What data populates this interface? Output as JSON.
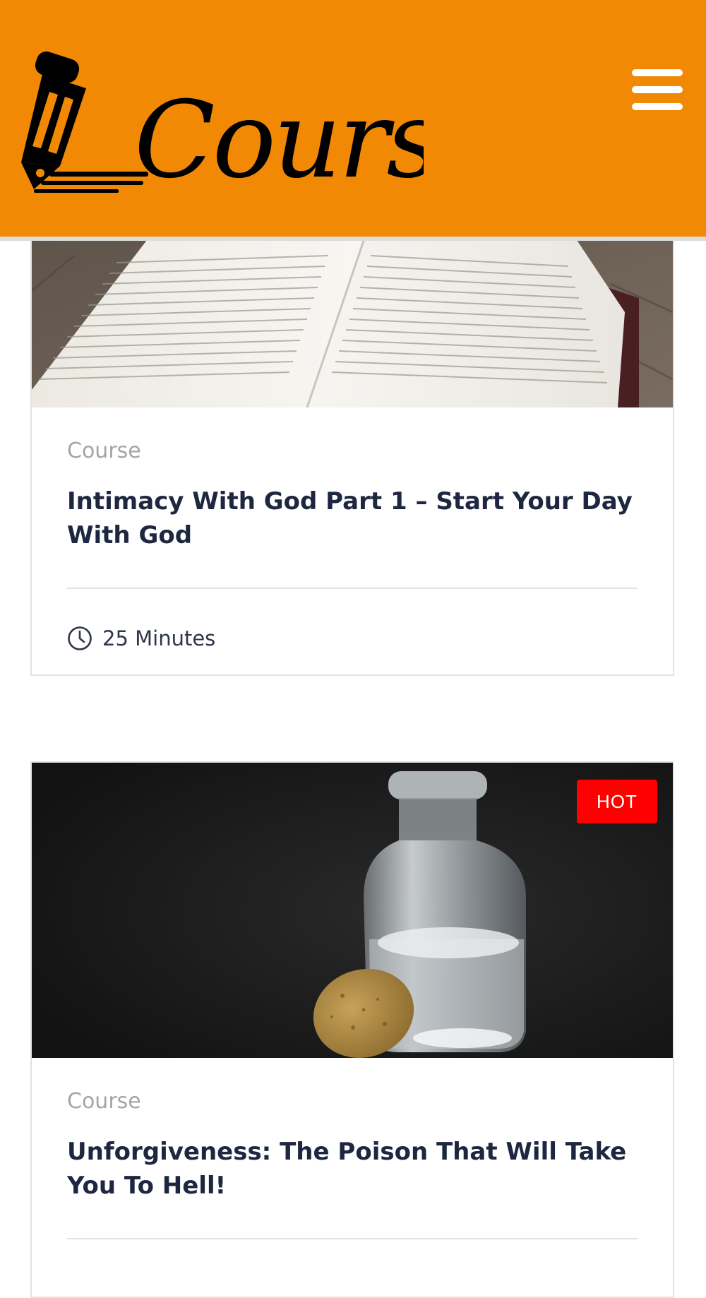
{
  "header": {
    "brand_name": "Coursely",
    "logo_icon": "pencil-icon",
    "menu_icon": "hamburger-menu-icon",
    "background_color": "#f18904"
  },
  "courses": [
    {
      "image": "open-book-photo",
      "category": "Course",
      "title": "Intimacy With God Part 1 – Start Your Day With God",
      "duration": "25 Minutes",
      "badge": ""
    },
    {
      "image": "poison-bottle-photo",
      "category": "Course",
      "title": "Unforgiveness: The Poison That Will Take You To Hell!",
      "badge": "HOT",
      "badge_color": "#ff0000"
    }
  ],
  "colors": {
    "title": "#1d2740",
    "category": "#a4a4a4",
    "border": "#e2e2e2"
  }
}
